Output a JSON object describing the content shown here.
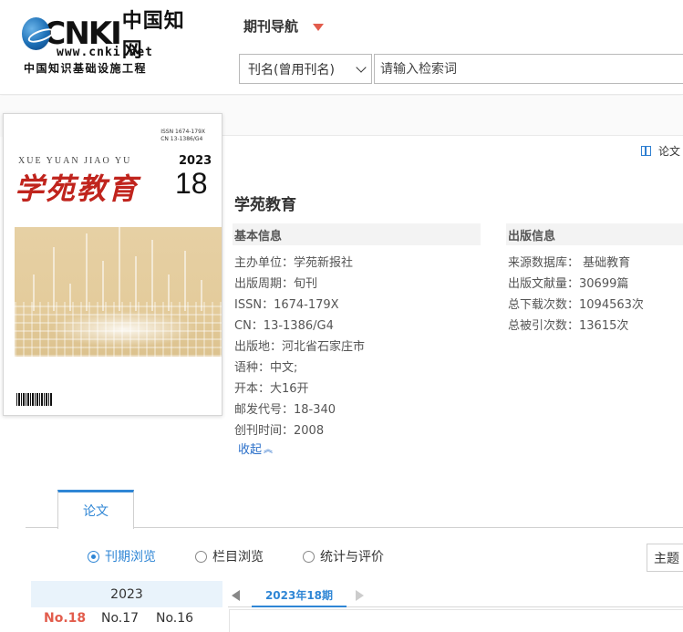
{
  "header": {
    "logo_brand": "CNKI",
    "logo_cn": "中国知网",
    "logo_url": "www.cnki.net",
    "logo_subtitle": "中国知识基础设施工程",
    "nav_title": "期刊导航",
    "search_field_selected": "刊名(曾用刊名)",
    "search_placeholder": "请输入检索词"
  },
  "toc_link_label": "论文",
  "cover": {
    "pinyin": "XUE YUAN JIAO YU",
    "title": "学苑教育",
    "year": "2023",
    "issue": "18",
    "isbn": "ISSN 1674-179X",
    "cn": "CN 13-1386/G4"
  },
  "journal": {
    "name": "学苑教育",
    "basic_heading": "基本信息",
    "pub_heading": "出版信息",
    "basic": [
      "主办单位：学苑新报社",
      "出版周期：旬刊",
      "ISSN：1674-179X",
      "CN：13-1386/G4",
      "出版地：河北省石家庄市",
      "语种：中文;",
      "开本：大16开",
      "邮发代号：18-340",
      "创刊时间：2008"
    ],
    "pub": [
      "来源数据库：  基础教育",
      "出版文献量：30699篇",
      "总下载次数：1094563次",
      "总被引次数：13615次"
    ],
    "collapse_label": "收起"
  },
  "tabs": {
    "paper": "论文"
  },
  "browse_modes": [
    {
      "label": "刊期浏览",
      "checked": true
    },
    {
      "label": "栏目浏览",
      "checked": false
    },
    {
      "label": "统计与评价",
      "checked": false
    }
  ],
  "topic_button": "主题",
  "year_panel": {
    "year": "2023",
    "issues": [
      "No.18",
      "No.17",
      "No.16"
    ]
  },
  "issue_tab": "2023年18期",
  "colors": {
    "accent_blue": "#2f86d5",
    "accent_red": "#e25c4c",
    "cover_red": "#c0241d"
  }
}
